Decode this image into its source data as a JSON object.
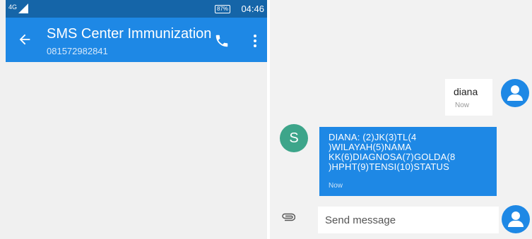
{
  "status_bar": {
    "network": "4G",
    "battery": "87%",
    "time": "04:46"
  },
  "header": {
    "title": "SMS Center Immunization",
    "phone_number": "081572982841"
  },
  "icons": {
    "back": "arrow-left-icon",
    "call": "phone-icon",
    "menu": "more-vert-icon",
    "attach": "paperclip-icon",
    "contact": "person-icon"
  },
  "colors": {
    "app_bar": "#1e88e5",
    "status_bar": "#1565a8",
    "incoming_bubble": "#1e88e5",
    "sender_avatar": "#3da58a"
  },
  "messages": [
    {
      "direction": "outgoing",
      "text": "diana",
      "time": "Now"
    },
    {
      "direction": "incoming",
      "sender_initial": "S",
      "text": "DIANA: (2)JK(3)TL(4 )WILAYAH(5)NAMA KK(6)DIAGNOSA(7)GOLDA(8 )HPHT(9)TENSI(10)STATUS",
      "time": "Now"
    }
  ],
  "composer": {
    "placeholder": "Send message"
  }
}
